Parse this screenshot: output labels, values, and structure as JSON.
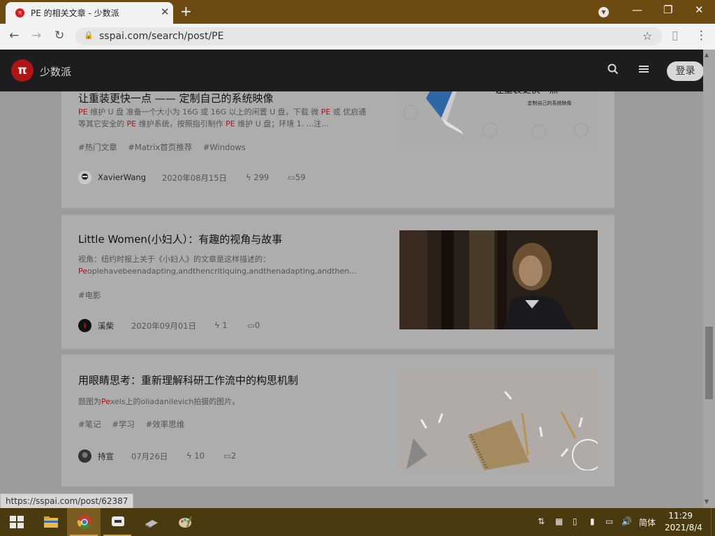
{
  "browser": {
    "tab_title": "PE 的相关文章 - 少数派",
    "url": "sspai.com/search/post/PE",
    "status_url": "https://sspai.com/post/62387"
  },
  "site": {
    "logo_glyph": "π",
    "name": "少数派",
    "login_label": "登录"
  },
  "articles": [
    {
      "title": "让重装更快一点 —— 定制自己的系统映像",
      "summary": [
        {
          "t": "PE",
          "hl": true
        },
        {
          "t": " 维护 U 盘 准备一个大小为 16G 或 16G 以上的闲置 U 盘，下载 微 "
        },
        {
          "t": "PE",
          "hl": true
        },
        {
          "t": " 或 优启通 等其它安全的 "
        },
        {
          "t": "PE",
          "hl": true
        },
        {
          "t": " 维护系统，按照指引制作 "
        },
        {
          "t": "PE",
          "hl": true
        },
        {
          "t": " 维护 U 盘；环境 1. ...注..."
        }
      ],
      "tags": [
        "#热门文章",
        "#Matrix首页推荐",
        "#Windows"
      ],
      "author": "XavierWang",
      "date": "2020年08月15日",
      "likes": "299",
      "comments": "59",
      "thumb_title": "让重装更快一点",
      "thumb_subtitle": "定制自己的系统映像"
    },
    {
      "title": "Little Women(小妇人）：有趣的视角与故事",
      "summary": [
        {
          "t": "视角：纽约时报上关于《小妇人》的文章是这样描述的："
        },
        {
          "t": "Pe",
          "hl": true
        },
        {
          "t": "oplehavebeenadapting,andthencritiquing,andthenadapting,andthen..."
        }
      ],
      "tags": [
        "#电影"
      ],
      "author": "溪柴",
      "date": "2020年09月01日",
      "likes": "1",
      "comments": "0"
    },
    {
      "title": "用眼睛思考：重新理解科研工作流中的构思机制",
      "summary": [
        {
          "t": "题图为"
        },
        {
          "t": "Pe",
          "hl": true
        },
        {
          "t": "xels上的oliadanilevich拍摄的图片。"
        }
      ],
      "tags": [
        "#笔记",
        "#学习",
        "#效率思维"
      ],
      "author": "持宣",
      "date": "07月26日",
      "likes": "10",
      "comments": "2"
    }
  ],
  "taskbar": {
    "ime": "简体",
    "time": "11:29",
    "date": "2021/8/4"
  },
  "icons": {
    "back": "arrow-left",
    "forward": "arrow-right",
    "reload": "refresh",
    "search": "magnifier",
    "menu": "hamburger",
    "like": "lightning",
    "comment": "speech-bubble"
  }
}
